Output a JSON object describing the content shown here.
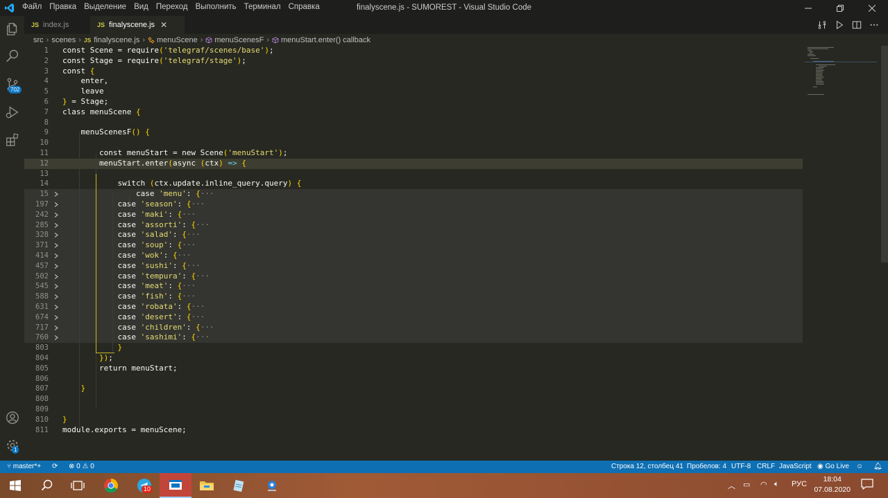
{
  "window": {
    "title": "finalyscene.js - SUMOREST - Visual Studio Code",
    "menu": [
      "Файл",
      "Правка",
      "Выделение",
      "Вид",
      "Переход",
      "Выполнить",
      "Терминал",
      "Справка"
    ]
  },
  "activity_bar": {
    "scm_badge": "702",
    "settings_badge": "1"
  },
  "tabs": [
    {
      "label": "index.js",
      "active": false,
      "icon": "JS"
    },
    {
      "label": "finalyscene.js",
      "active": true,
      "icon": "JS"
    }
  ],
  "breadcrumb": {
    "src": "src",
    "scenes": "scenes",
    "file": "finalyscene.js",
    "file_icon": "JS",
    "class": "menuScene",
    "method": "menuScenesF",
    "callback": "menuStart.enter() callback"
  },
  "code": [
    {
      "n": "1",
      "text": "const Scene = require('telegraf/scenes/base');"
    },
    {
      "n": "2",
      "text": "const Stage = require('telegraf/stage');"
    },
    {
      "n": "3",
      "text": "const {"
    },
    {
      "n": "4",
      "text": "    enter,"
    },
    {
      "n": "5",
      "text": "    leave"
    },
    {
      "n": "6",
      "text": "} = Stage;"
    },
    {
      "n": "7",
      "text": "class menuScene {"
    },
    {
      "n": "8",
      "text": ""
    },
    {
      "n": "9",
      "text": "    menuScenesF() {"
    },
    {
      "n": "10",
      "text": ""
    },
    {
      "n": "11",
      "text": "        const menuStart = new Scene('menuStart');"
    },
    {
      "n": "12",
      "text": "        menuStart.enter(async (ctx) => {"
    },
    {
      "n": "13",
      "text": ""
    },
    {
      "n": "14",
      "text": "            switch (ctx.update.inline_query.query) {"
    },
    {
      "n": "15",
      "text": "                case 'menu': {···"
    },
    {
      "n": "197",
      "text": "            case 'season': {···"
    },
    {
      "n": "242",
      "text": "            case 'maki': {···"
    },
    {
      "n": "285",
      "text": "            case 'assorti': {···"
    },
    {
      "n": "328",
      "text": "            case 'salad': {···"
    },
    {
      "n": "371",
      "text": "            case 'soup': {···"
    },
    {
      "n": "414",
      "text": "            case 'wok': {···"
    },
    {
      "n": "457",
      "text": "            case 'sushi': {···"
    },
    {
      "n": "502",
      "text": "            case 'tempura': {···"
    },
    {
      "n": "545",
      "text": "            case 'meat': {···"
    },
    {
      "n": "588",
      "text": "            case 'fish': {···"
    },
    {
      "n": "631",
      "text": "            case 'robata': {···"
    },
    {
      "n": "674",
      "text": "            case 'desert': {···"
    },
    {
      "n": "717",
      "text": "            case 'children': {···"
    },
    {
      "n": "760",
      "text": "            case 'sashimi': {···"
    },
    {
      "n": "803",
      "text": "            }"
    },
    {
      "n": "804",
      "text": "        });"
    },
    {
      "n": "805",
      "text": "        return menuStart;"
    },
    {
      "n": "806",
      "text": ""
    },
    {
      "n": "807",
      "text": "    }"
    },
    {
      "n": "808",
      "text": ""
    },
    {
      "n": "809",
      "text": ""
    },
    {
      "n": "810",
      "text": "}"
    },
    {
      "n": "811",
      "text": "module.exports = menuScene;"
    }
  ],
  "statusbar": {
    "branch": "master*+",
    "errors": "0",
    "warnings": "0",
    "position": "Строка 12, столбец 41",
    "spaces": "Пробелов: 4",
    "encoding": "UTF-8",
    "eol": "CRLF",
    "language": "JavaScript",
    "golive": "Go Live"
  },
  "taskbar": {
    "lang": "РУС",
    "time": "18:04",
    "date": "07.08.2020",
    "telegram_badge": "10"
  },
  "colors": {
    "editor_bg": "#272822",
    "status_bg": "#0e6fb3",
    "accent_blue": "#0b75c2"
  }
}
